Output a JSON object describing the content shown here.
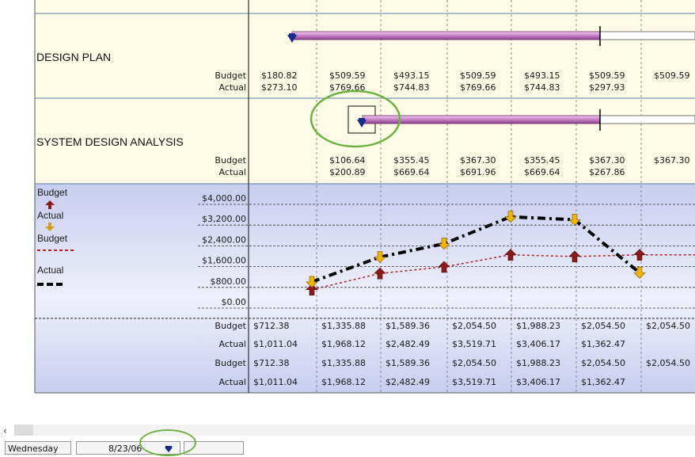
{
  "tasks": [
    {
      "name": "DESIGN PLAN",
      "rows": [
        {
          "label": "Budget",
          "values": [
            "$180.82",
            "$509.59",
            "$493.15",
            "$509.59",
            "$493.15",
            "$509.59",
            "$509.59"
          ]
        },
        {
          "label": "Actual",
          "values": [
            "$273.10",
            "$769.66",
            "$744.83",
            "$769.66",
            "$744.83",
            "$297.93",
            ""
          ]
        }
      ]
    },
    {
      "name": "SYSTEM DESIGN ANALYSIS",
      "rows": [
        {
          "label": "Budget",
          "values": [
            "",
            "$106.64",
            "$355.45",
            "$367.30",
            "$355.45",
            "$367.30",
            "$367.30"
          ]
        },
        {
          "label": "Actual",
          "values": [
            "",
            "$200.89",
            "$669.64",
            "$691.96",
            "$669.64",
            "$267.86",
            ""
          ]
        }
      ]
    }
  ],
  "legend": {
    "items": [
      {
        "label": "Budget",
        "icon": "budget-arrow-icon",
        "color": "#8b1a1a"
      },
      {
        "label": "Actual",
        "icon": "actual-arrow-icon",
        "color": "#d4a017"
      },
      {
        "label": "Budget",
        "icon": "budget-line-icon",
        "color": "#b22222"
      },
      {
        "label": "Actual",
        "icon": "actual-line-icon",
        "color": "#000000"
      }
    ]
  },
  "chart_data": {
    "type": "line",
    "y_ticks": [
      "$4,000.00",
      "$3,200.00",
      "$2,400.00",
      "$1,600.00",
      "$800.00",
      "$0.00"
    ],
    "ylim": [
      0,
      4000
    ],
    "series": [
      {
        "name": "Budget",
        "values": [
          712.38,
          1335.88,
          1589.36,
          2054.5,
          1988.23,
          2054.5,
          2054.5
        ]
      },
      {
        "name": "Actual",
        "values": [
          1011.04,
          1968.12,
          2482.49,
          3519.71,
          3406.17,
          1362.47
        ]
      }
    ],
    "grid": true
  },
  "summary_rows": [
    {
      "label": "Budget",
      "values": [
        "$712.38",
        "$1,335.88",
        "$1,589.36",
        "$2,054.50",
        "$1,988.23",
        "$2,054.50",
        "$2,054.50"
      ]
    },
    {
      "label": "Actual",
      "values": [
        "$1,011.04",
        "$1,968.12",
        "$2,482.49",
        "$3,519.71",
        "$3,406.17",
        "$1,362.47",
        ""
      ]
    },
    {
      "label": "Budget",
      "values": [
        "$712.38",
        "$1,335.88",
        "$1,589.36",
        "$2,054.50",
        "$1,988.23",
        "$2,054.50",
        "$2,054.50"
      ]
    },
    {
      "label": "Actual",
      "values": [
        "$1,011.04",
        "$1,968.12",
        "$2,482.49",
        "$3,519.71",
        "$3,406.17",
        "$1,362.47",
        ""
      ]
    }
  ],
  "statusbar": {
    "scroll_left": "‹",
    "day": "Wednesday",
    "date": "8/23/06",
    "date_icon": "task-arrow-icon"
  },
  "colors": {
    "task_bg": "#fdfbe6",
    "chart_bg_top": "#cdd0ef",
    "chart_bg_bottom": "#f4f4fc",
    "budget_line": "#b22222",
    "actual_line": "#000000",
    "budget_arrow": "#8b1a1a",
    "actual_arrow": "#f0b400",
    "gantt_bar": "#c87fc8",
    "highlight": "#6bb23f"
  }
}
